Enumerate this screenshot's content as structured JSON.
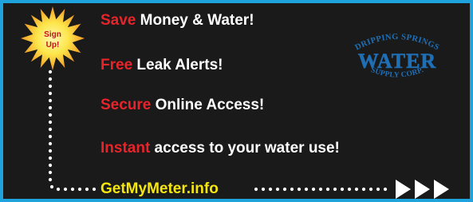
{
  "starburst": {
    "line1": "Sign",
    "line2": "Up!"
  },
  "benefits": [
    {
      "highlight": "Save",
      "rest": " Money & Water!"
    },
    {
      "highlight": "Free",
      "rest": " Leak Alerts!"
    },
    {
      "highlight": "Secure",
      "rest": " Online Access!"
    },
    {
      "highlight": "Instant",
      "rest": " access to your water use!"
    }
  ],
  "cta": {
    "url": "GetMyMeter.info",
    "arrow_count": 3
  },
  "logo": {
    "top_text": "DRIPPING SPRINGS",
    "center_text": "WATER",
    "bottom_text": "SUPPLY CORP."
  },
  "colors": {
    "frame": "#1ea3dd",
    "background": "#1a1a1a",
    "highlight_red": "#e8242b",
    "cta_yellow": "#f6e610",
    "logo_blue": "#1f6fb6",
    "star_orange": "#f59b22"
  }
}
